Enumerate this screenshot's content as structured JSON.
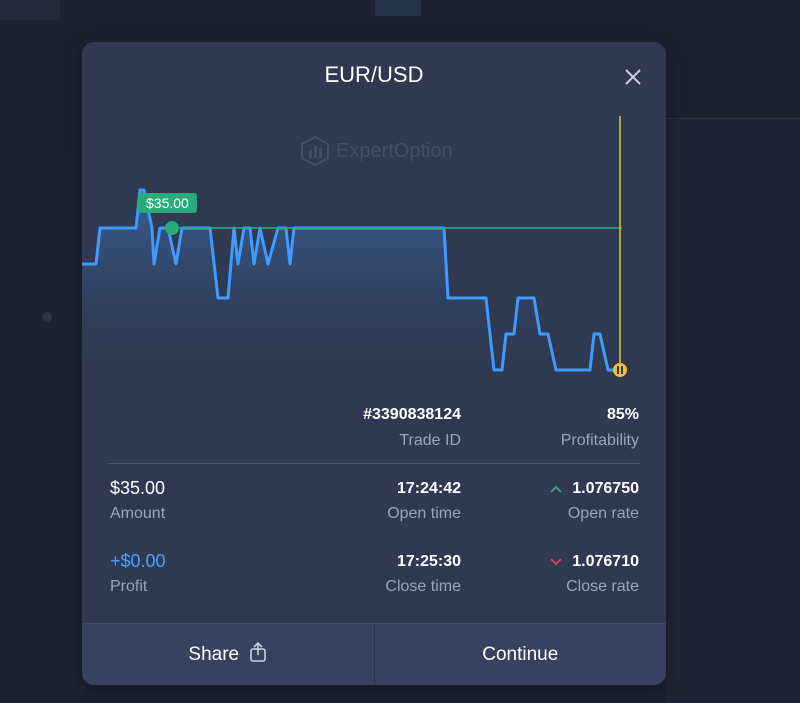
{
  "modal": {
    "title": "EUR/USD",
    "watermark": "ExpertOption"
  },
  "chart_data": {
    "type": "line",
    "entry_label": "$35.00",
    "colors": {
      "line": "#3f9bff",
      "entry_line": "#2bab79",
      "close_marker": "#f2c230"
    }
  },
  "trade": {
    "id_value": "#3390838124",
    "id_label": "Trade ID",
    "profitability_value": "85%",
    "profitability_label": "Profitability",
    "amount_value": "$35.00",
    "amount_label": "Amount",
    "open_time_value": "17:24:42",
    "open_time_label": "Open time",
    "open_rate_value": "1.076750",
    "open_rate_label": "Open rate",
    "profit_value": "+$0.00",
    "profit_label": "Profit",
    "close_time_value": "17:25:30",
    "close_time_label": "Close time",
    "close_rate_value": "1.076710",
    "close_rate_label": "Close rate"
  },
  "footer": {
    "share_label": "Share",
    "continue_label": "Continue"
  }
}
